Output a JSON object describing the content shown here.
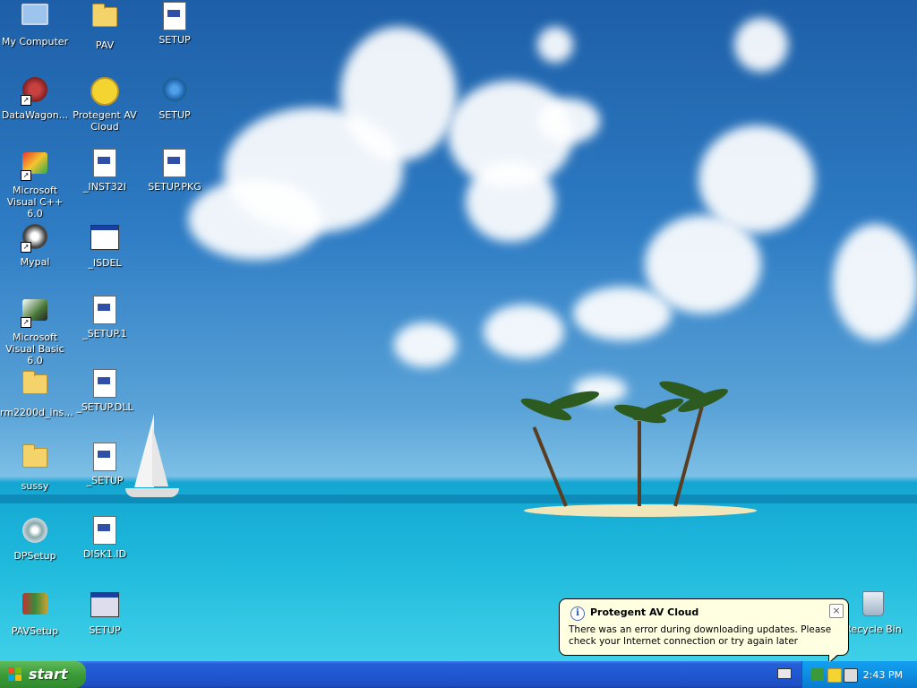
{
  "desktop": {
    "icons": [
      {
        "label": "My Computer"
      },
      {
        "label": "PAV"
      },
      {
        "label": "SETUP"
      },
      {
        "label": "DataWagon..."
      },
      {
        "label": "Protegent  AV Cloud"
      },
      {
        "label": "SETUP"
      },
      {
        "label": "Microsoft Visual C++ 6.0"
      },
      {
        "label": "_INST32I"
      },
      {
        "label": "SETUP.PKG"
      },
      {
        "label": "Mypal"
      },
      {
        "label": "_ISDEL"
      },
      {
        "label": "Microsoft Visual Basic 6.0"
      },
      {
        "label": "_SETUP.1"
      },
      {
        "label": "rm2200d_ins..."
      },
      {
        "label": "_SETUP.DLL"
      },
      {
        "label": "sussy"
      },
      {
        "label": "_SETUP"
      },
      {
        "label": "DPSetup"
      },
      {
        "label": "DISK1.ID"
      },
      {
        "label": "PAVSetup"
      },
      {
        "label": "SETUP"
      }
    ],
    "recycle_bin": {
      "label": "Recycle Bin"
    }
  },
  "balloon": {
    "title": "Protegent AV Cloud",
    "message": "There was an error during downloading updates. Please check your Internet connection or try again later",
    "info_glyph": "i",
    "close_glyph": "×"
  },
  "taskbar": {
    "start_label": "start",
    "clock": "2:43 PM"
  },
  "colors": {
    "taskbar": "#2157d0",
    "start_button": "#3c9a38",
    "tray": "#0f8fe2",
    "balloon_bg": "#ffffe1"
  }
}
